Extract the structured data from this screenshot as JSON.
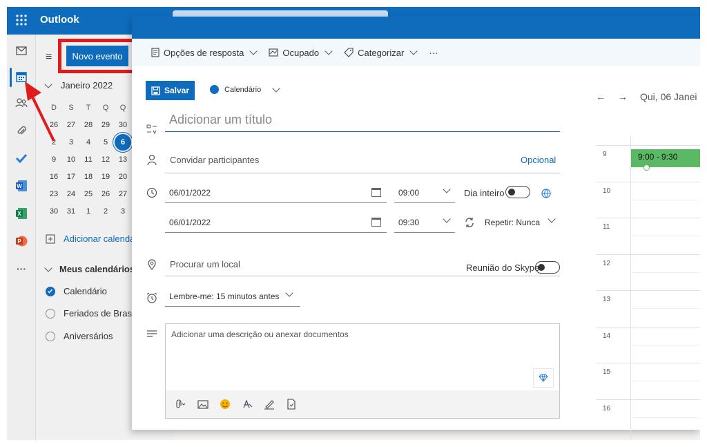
{
  "app": {
    "name": "Outlook"
  },
  "nav": {
    "new_event": "Novo evento",
    "month": "Janeiro 2022",
    "weekdays": [
      "D",
      "S",
      "T",
      "Q",
      "Q"
    ],
    "weeks": [
      [
        "26",
        "27",
        "28",
        "29",
        "30"
      ],
      [
        "2",
        "3",
        "4",
        "5",
        "6"
      ],
      [
        "9",
        "10",
        "11",
        "12",
        "13"
      ],
      [
        "16",
        "17",
        "18",
        "19",
        "20"
      ],
      [
        "23",
        "24",
        "25",
        "26",
        "27"
      ],
      [
        "30",
        "31",
        "1",
        "2",
        "3"
      ]
    ],
    "add_calendar": "Adicionar calendá",
    "my_calendars": "Meus calendários",
    "calendars": [
      {
        "label": "Calendário",
        "checked": true
      },
      {
        "label": "Feriados de Brasil",
        "checked": false
      },
      {
        "label": "Aniversários",
        "checked": false
      }
    ]
  },
  "dialog": {
    "commands": [
      "Opções de resposta",
      "Ocupado",
      "Categorizar",
      "···"
    ],
    "save": "Salvar",
    "calendar": "Calendário",
    "title_placeholder": "Adicionar um título",
    "invite_placeholder": "Convidar participantes",
    "optional": "Opcional",
    "start_date": "06/01/2022",
    "start_time": "09:00",
    "all_day": "Dia inteiro",
    "end_date": "06/01/2022",
    "end_time": "09:30",
    "repeat": "Repetir:  Nunca",
    "location_placeholder": "Procurar um local",
    "skype": "Reunião do Skype",
    "reminder": "Lembre-me:  15 minutos antes",
    "description_placeholder": "Adicionar uma descrição ou anexar documentos"
  },
  "dayview": {
    "date": "Qui, 06 Janei",
    "hours": [
      "9",
      "10",
      "11",
      "12",
      "13",
      "14",
      "15",
      "16"
    ],
    "event": "9:00 - 9:30"
  },
  "colors": {
    "brand": "#0f6cbd",
    "event": "#5bb864",
    "highlight": "#e01b1b"
  },
  "icons": [
    "waffle-icon",
    "mail-icon",
    "calendar-icon",
    "people-icon",
    "paperclip-icon",
    "todo-icon",
    "word-icon",
    "excel-icon",
    "powerpoint-icon",
    "more-icon"
  ]
}
